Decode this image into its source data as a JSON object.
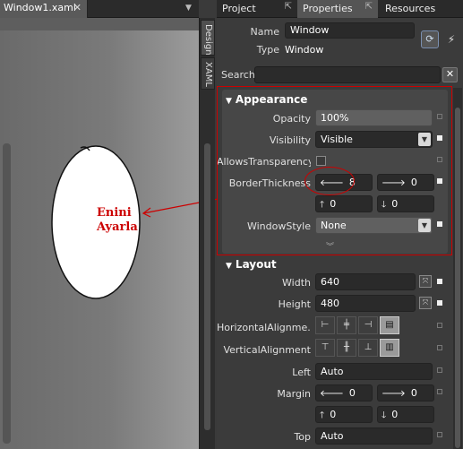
{
  "doc": {
    "tab_title": "Window1.xaml",
    "close_glyph": "✕",
    "dropdown_glyph": "▼",
    "side_tabs": {
      "design": "Design",
      "xaml": "XAML"
    },
    "annotation": {
      "line1": "Enini",
      "line2": "Ayarla"
    },
    "annotation_color": "#cc0000"
  },
  "panel": {
    "tabs": [
      {
        "label": "Project",
        "pin": "⇱"
      },
      {
        "label": "Properties",
        "pin": "⇱"
      },
      {
        "label": "Resources"
      }
    ],
    "name_label": "Name",
    "name_value": "Window",
    "type_label": "Type",
    "type_value": "Window",
    "event_icon": "⟳",
    "lightning_icon": "⚡",
    "search_label": "Search",
    "search_value": "",
    "search_clear": "✕"
  },
  "appearance": {
    "header": "Appearance",
    "opacity_label": "Opacity",
    "opacity_value": "100%",
    "visibility_label": "Visibility",
    "visibility_value": "Visible",
    "allows_label": "AllowsTransparency",
    "border_label": "BorderThickness",
    "border": {
      "left": "8",
      "right": "0",
      "top": "0",
      "bottom": "0"
    },
    "windowstyle_label": "WindowStyle",
    "windowstyle_value": "None"
  },
  "layout": {
    "header": "Layout",
    "width_label": "Width",
    "width_value": "640",
    "height_label": "Height",
    "height_value": "480",
    "halign_label": "HorizontalAlignme...",
    "valign_label": "VerticalAlignment",
    "left_label": "Left",
    "left_value": "Auto",
    "margin_label": "Margin",
    "margin": {
      "left": "0",
      "right": "0",
      "top": "0",
      "bottom": "0"
    },
    "top_label": "Top",
    "top_value": "Auto"
  },
  "colors": {
    "highlight_box": "#cc0000",
    "panel_bg": "#3b3b3b"
  }
}
